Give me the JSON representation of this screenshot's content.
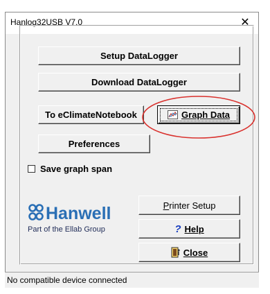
{
  "window": {
    "title": "Hanlog32USB V7.0",
    "close_glyph": "✕"
  },
  "buttons": {
    "setup": "Setup DataLogger",
    "download": "Download DataLogger",
    "eclimate": "To eClimateNotebook",
    "graph": "Graph Data",
    "preferences": "Preferences",
    "printer_setup": "Printer Setup",
    "help": "Help",
    "close": "Close"
  },
  "checkbox": {
    "label": "Save graph span",
    "checked": false
  },
  "logo": {
    "brand": "Hanwell",
    "tagline": "Part of the Ellab Group",
    "brand_color": "#2a6fb5"
  },
  "status": {
    "text": "No compatible device connected"
  },
  "annotation": {
    "color": "#d9302c"
  }
}
